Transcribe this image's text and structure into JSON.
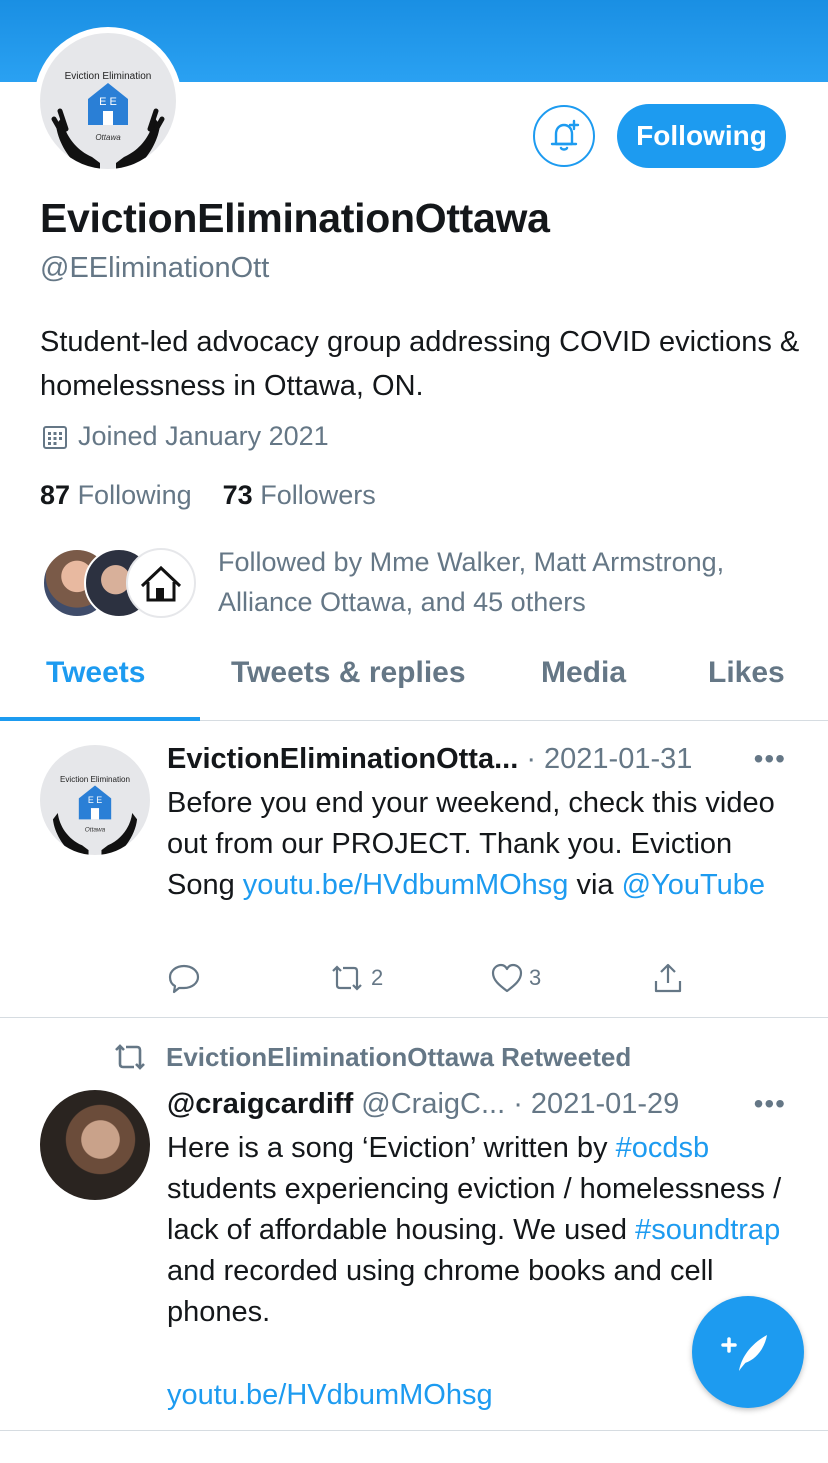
{
  "profile": {
    "logo_text_top": "Eviction Elimination",
    "logo_text_letters": "E E",
    "logo_text_bottom": "Ottawa",
    "follow_label": "Following",
    "display_name": "EvictionEliminationOttawa",
    "handle": "@EEliminationOtt",
    "bio": "Student-led advocacy group addressing COVID evictions & homelessness in Ottawa, ON.",
    "joined": "Joined January 2021",
    "following_count": "87",
    "following_label": "Following",
    "followers_count": "73",
    "followers_label": "Followers",
    "followed_by": "Followed by Mme Walker, Matt Armstrong, Alliance Ottawa, and 45 others"
  },
  "tabs": [
    {
      "label": "Tweets",
      "active": true
    },
    {
      "label": "Tweets & replies",
      "active": false
    },
    {
      "label": "Media",
      "active": false
    },
    {
      "label": "Likes",
      "active": false
    }
  ],
  "tweets": [
    {
      "name": "EvictionEliminationOtta...",
      "meta": "· 2021-01-31",
      "text_1": "Before you end your weekend, check this video out from our PROJECT. Thank you. Eviction Song ",
      "link_1": "youtu.be/HVdbumMOhsg",
      "text_2": " via ",
      "link_2": "@YouTube",
      "retweets": "2",
      "likes": "3"
    },
    {
      "retweeted_by": "EvictionEliminationOttawa Retweeted",
      "name": "@craigcardiff",
      "handle": "@CraigC...",
      "meta": "· 2021-01-29",
      "text_1": "Here is a song ‘Eviction’ written by ",
      "tag_1": "#ocdsb",
      "text_2": " students experiencing eviction / homelessness / lack of affordable housing. We used ",
      "tag_2": "#soundtrap",
      "text_3": " and recorded using chrome books and cell phones.",
      "link": "youtu.be/HVdbumMOhsg"
    }
  ],
  "colors": {
    "accent": "#1d9bf0",
    "muted": "#657786",
    "text": "#14171a"
  },
  "icons": [
    "bell-plus-icon",
    "calendar-icon",
    "reply-icon",
    "retweet-icon",
    "like-icon",
    "share-icon",
    "compose-icon",
    "more-icon"
  ]
}
